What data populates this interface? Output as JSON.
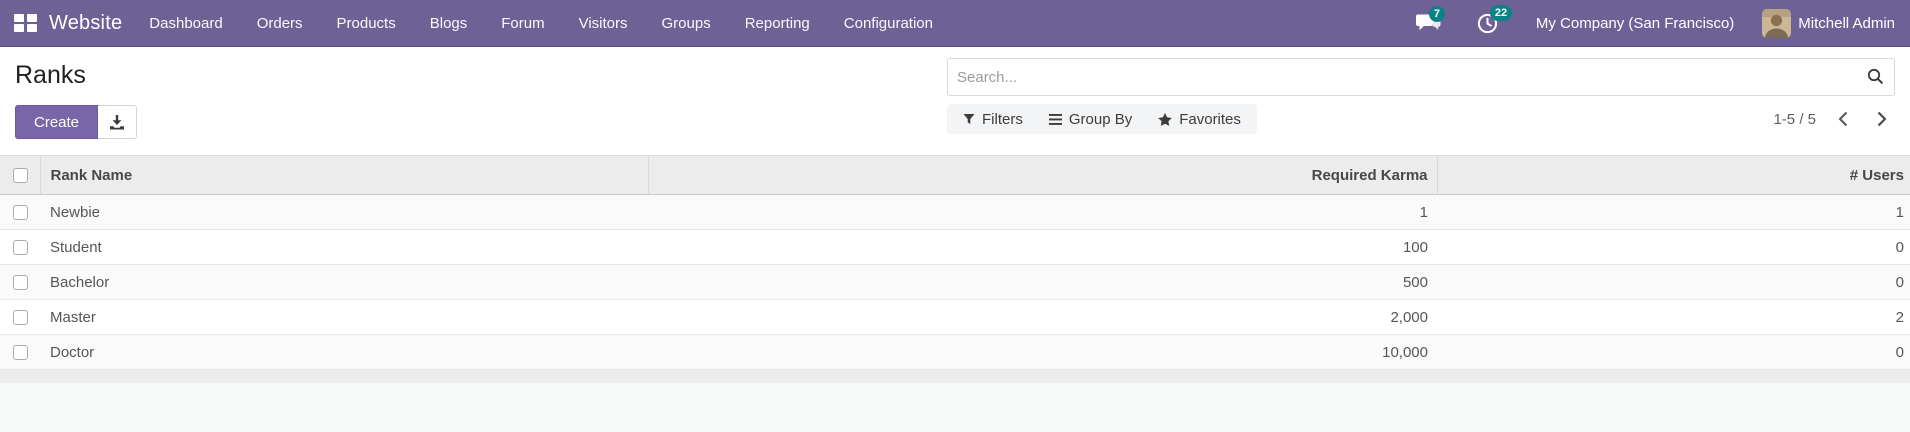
{
  "navbar": {
    "app_name": "Website",
    "menu_items": [
      "Dashboard",
      "Orders",
      "Products",
      "Blogs",
      "Forum",
      "Visitors",
      "Groups",
      "Reporting",
      "Configuration"
    ],
    "messages_badge": "7",
    "activities_badge": "22",
    "company": "My Company (San Francisco)",
    "user": "Mitchell Admin"
  },
  "control_panel": {
    "title": "Ranks",
    "create_label": "Create",
    "search_placeholder": "Search...",
    "filters_label": "Filters",
    "group_by_label": "Group By",
    "favorites_label": "Favorites",
    "pager_text": "1-5 / 5"
  },
  "table": {
    "columns": {
      "rank_name": "Rank Name",
      "required_karma": "Required Karma",
      "users": "# Users"
    },
    "rows": [
      {
        "rank_name": "Newbie",
        "required_karma": "1",
        "users": "1"
      },
      {
        "rank_name": "Student",
        "required_karma": "100",
        "users": "0"
      },
      {
        "rank_name": "Bachelor",
        "required_karma": "500",
        "users": "0"
      },
      {
        "rank_name": "Master",
        "required_karma": "2,000",
        "users": "2"
      },
      {
        "rank_name": "Doctor",
        "required_karma": "10,000",
        "users": "0"
      }
    ]
  },
  "icons": [
    "apps-grid-icon",
    "chat-icon",
    "activity-clock-icon",
    "search-icon",
    "download-icon",
    "filter-funnel-icon",
    "group-by-icon",
    "star-icon",
    "chevron-left-icon",
    "chevron-right-icon",
    "checkbox"
  ],
  "colors": {
    "navbar_bg": "#6e6196",
    "primary_button": "#7866a8",
    "badge": "#0b8285",
    "header_bg": "#ececec",
    "stripe_row": "#fafafa"
  }
}
